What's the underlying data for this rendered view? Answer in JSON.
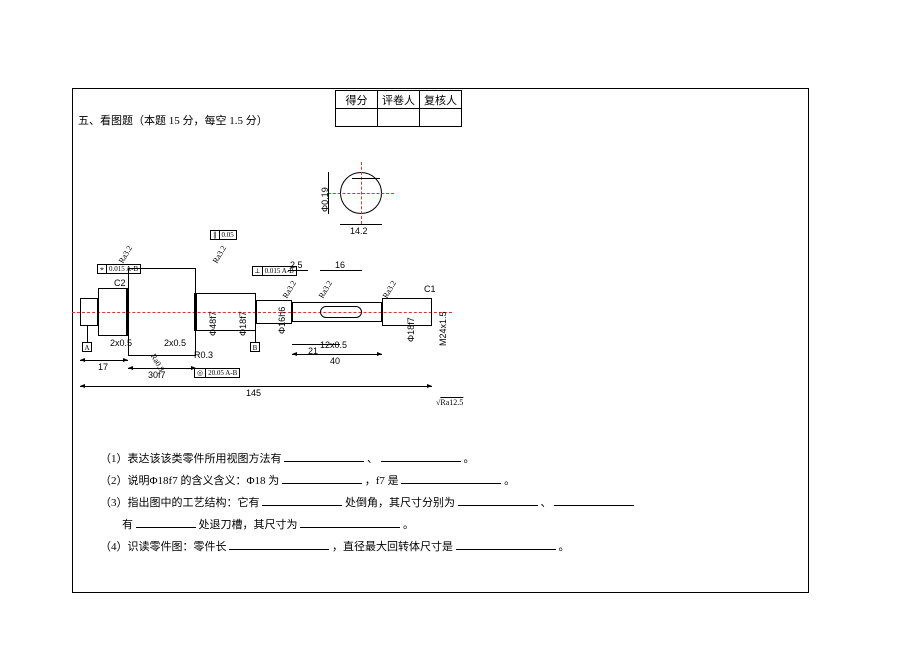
{
  "section_title": "五、看图题（本题 15 分，每空 1.5 分）",
  "score_headers": {
    "c1": "得分",
    "c2": "评卷人",
    "c3": "复核人"
  },
  "drawing": {
    "dims": {
      "len_17": "17",
      "len_30f7": "30f7",
      "len_145": "145",
      "len_40": "40",
      "len_21": "21",
      "len_16": "16",
      "len_2p5": "2.5",
      "len_14p2": "14.2",
      "groove_2x05": "2x0.5",
      "chamfer_c2": "C2",
      "chamfer_c1": "C1",
      "dia_48f7": "Φ48f7",
      "dia_18f7": "Φ18f7",
      "dia_16h6": "Φ16h6",
      "dia_2005": "Φ20.05",
      "m24x15": "M24x1.5",
      "dia_019_end": "Φ0.19",
      "tol_0015": "0.015",
      "tol_0015ab": "0.015 A-B",
      "tol_005": "0.05",
      "tol_2005ab": "20.05 A-B",
      "datum_a": "A",
      "datum_b": "B",
      "ra12p5": "Ra12.5",
      "ra08": "Ra0.8",
      "ra32": "Ra3.2",
      "r_small": "R0.3"
    }
  },
  "questions": {
    "q1": "（1）表达该该类零件所用视图方法有",
    "q1_sep": "、",
    "q1_end": "。",
    "q2a": "（2）说明Φ18f7 的含义含义：Φ18 为",
    "q2b": "，f7 是",
    "q2_end": "。",
    "q3a": "（3）指出图中的工艺结构：它有",
    "q3b": "处倒角，其尺寸分别为",
    "q3_sep": "、",
    "q3c": "有",
    "q3d": " 处退刀槽，其尺寸为",
    "q3_end": "。",
    "q4a": "（4）识读零件图：零件长",
    "q4b": "，直径最大回转体尺寸是",
    "q4_end": "。"
  }
}
